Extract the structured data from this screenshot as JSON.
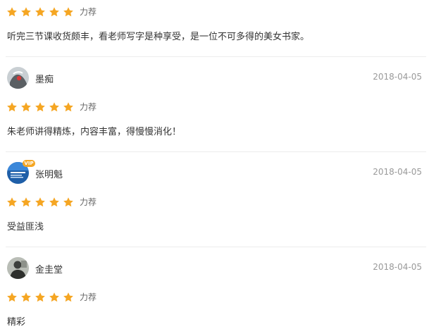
{
  "colors": {
    "star": "#f5a623",
    "divider": "#ececec",
    "date": "#999999",
    "text": "#333333"
  },
  "reviews": [
    {
      "stars": 5,
      "rating_label": "力荐",
      "comment": "听完三节课收货颇丰，看老师写字是种享受，是一位不可多得的美女书家。"
    },
    {
      "username": "墨痴",
      "date": "2018-04-05",
      "stars": 5,
      "rating_label": "力荐",
      "comment": "朱老师讲得精炼，内容丰富，得慢慢消化！"
    },
    {
      "username": "张明魁",
      "vip_badge": "VIP",
      "date": "2018-04-05",
      "stars": 5,
      "rating_label": "力荐",
      "comment": "受益匪浅"
    },
    {
      "username": "金圭堂",
      "date": "2018-04-05",
      "stars": 5,
      "rating_label": "力荐",
      "comment": "精彩"
    }
  ]
}
